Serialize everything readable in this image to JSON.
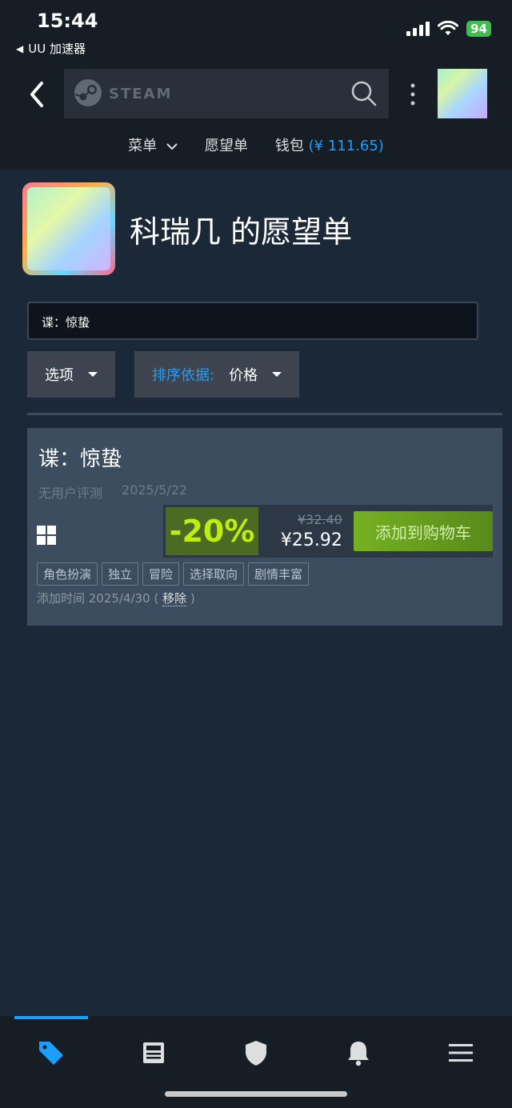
{
  "status_bar": {
    "time": "15:44",
    "back_app": "UU 加速器",
    "battery": "94"
  },
  "header": {
    "search_brand": "STEAM",
    "menu_label": "菜单",
    "wishlist_label": "愿望单",
    "wallet_label": "钱包",
    "wallet_amount": "(¥ 111.65)"
  },
  "profile": {
    "title": "科瑞几 的愿望单"
  },
  "filter": {
    "value": "谍：惊蛰"
  },
  "controls": {
    "options_label": "选项",
    "sort_prefix": "排序依据:",
    "sort_value": "价格"
  },
  "items": [
    {
      "title": "谍：惊蛰",
      "review": "无用户评测",
      "release_date": "2025/5/22",
      "platform": "windows-icon",
      "discount": "-20%",
      "original_price": "¥32.40",
      "final_price": "¥25.92",
      "cart_label": "添加到购物车",
      "tags": [
        "角色扮演",
        "独立",
        "冒险",
        "选择取向",
        "剧情丰富"
      ],
      "added_prefix": "添加时间 2025/4/30 (",
      "remove_label": "移除",
      "added_suffix": ")"
    }
  ],
  "tabbar": {
    "tabs": [
      "tag-icon",
      "news-icon",
      "shield-icon",
      "bell-icon",
      "menu-icon"
    ],
    "active_color": "#1a9fff"
  },
  "colors": {
    "accent": "#1a9fff",
    "discount_green": "#beee11",
    "background": "#1b2838"
  }
}
